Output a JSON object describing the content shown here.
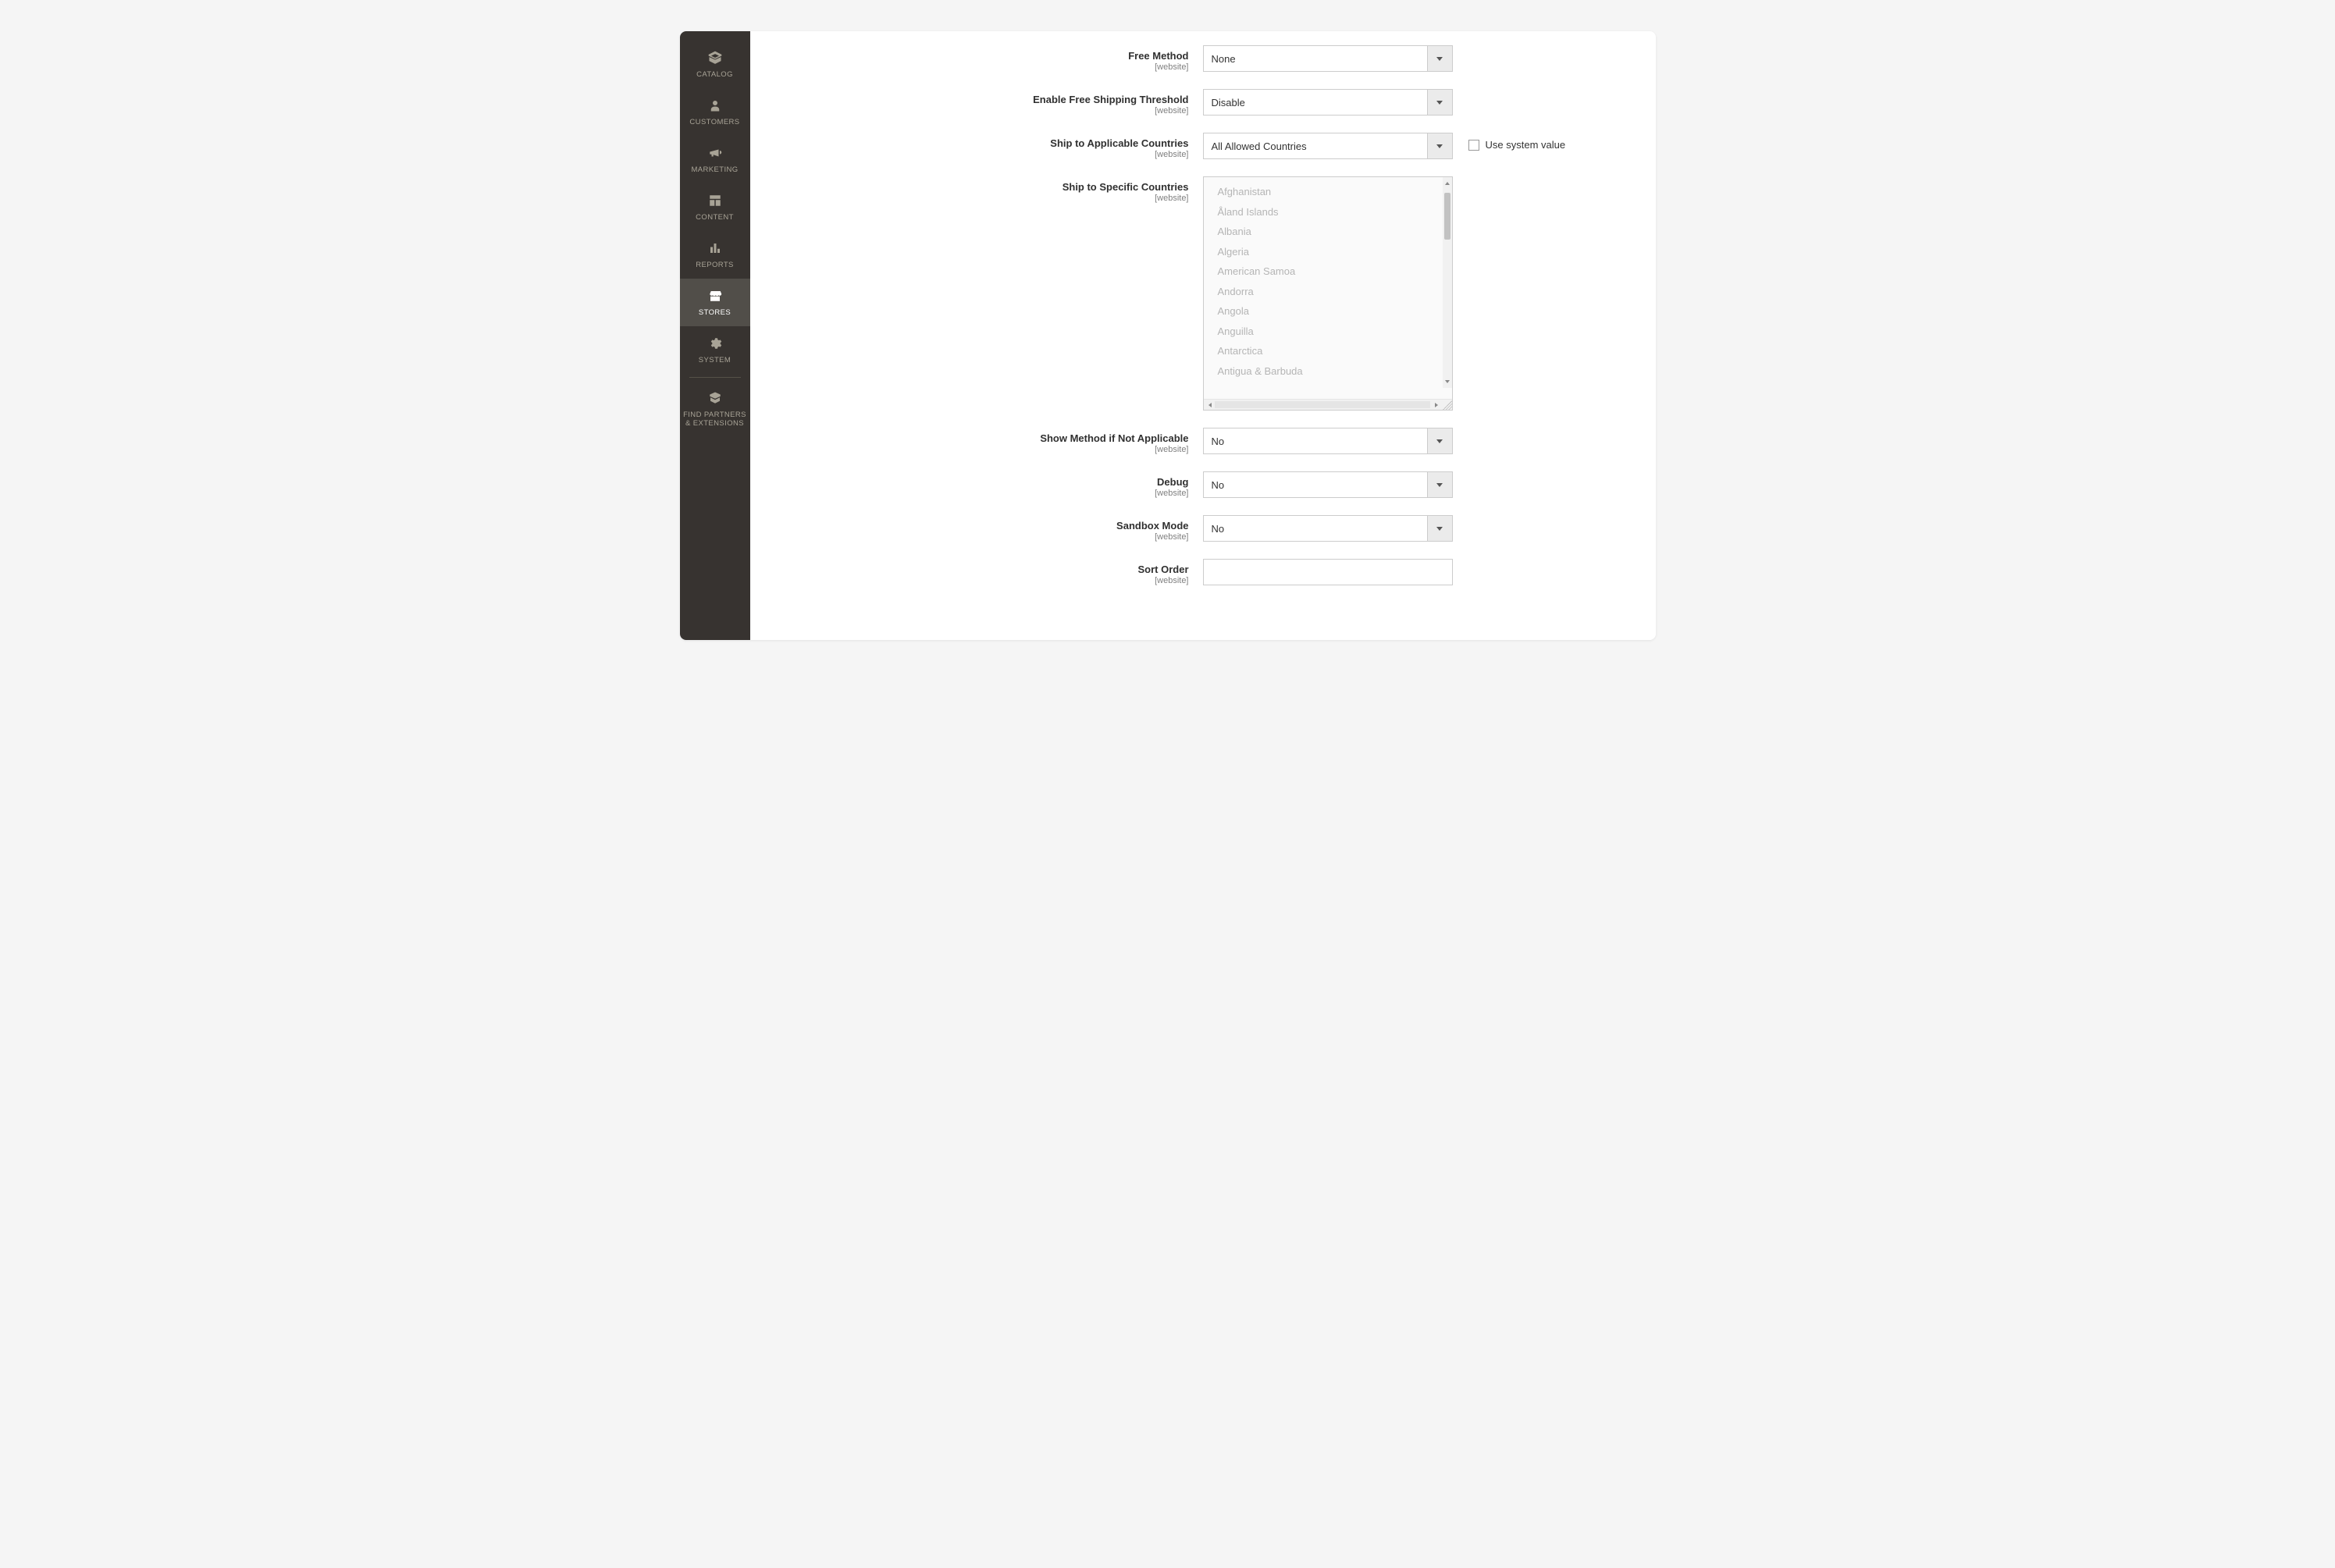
{
  "sidebar": {
    "items": [
      {
        "id": "catalog",
        "label": "CATALOG"
      },
      {
        "id": "customers",
        "label": "CUSTOMERS"
      },
      {
        "id": "marketing",
        "label": "MARKETING"
      },
      {
        "id": "content",
        "label": "CONTENT"
      },
      {
        "id": "reports",
        "label": "REPORTS"
      },
      {
        "id": "stores",
        "label": "STORES",
        "active": true
      },
      {
        "id": "system",
        "label": "SYSTEM"
      },
      {
        "id": "partners",
        "label": "FIND PARTNERS",
        "label2": "& EXTENSIONS"
      }
    ]
  },
  "scope_text": "[website]",
  "use_system_value_label": "Use system value",
  "fields": {
    "free_method": {
      "label": "Free Method",
      "value": "None"
    },
    "enable_free_threshold": {
      "label": "Enable Free Shipping Threshold",
      "value": "Disable"
    },
    "ship_applicable": {
      "label": "Ship to Applicable Countries",
      "value": "All Allowed Countries",
      "has_system_checkbox": true
    },
    "ship_specific": {
      "label": "Ship to Specific Countries",
      "options": [
        "Afghanistan",
        "Åland Islands",
        "Albania",
        "Algeria",
        "American Samoa",
        "Andorra",
        "Angola",
        "Anguilla",
        "Antarctica",
        "Antigua & Barbuda"
      ]
    },
    "show_method_na": {
      "label": "Show Method if Not Applicable",
      "value": "No"
    },
    "debug": {
      "label": "Debug",
      "value": "No"
    },
    "sandbox": {
      "label": "Sandbox Mode",
      "value": "No"
    },
    "sort_order": {
      "label": "Sort Order",
      "value": ""
    }
  }
}
